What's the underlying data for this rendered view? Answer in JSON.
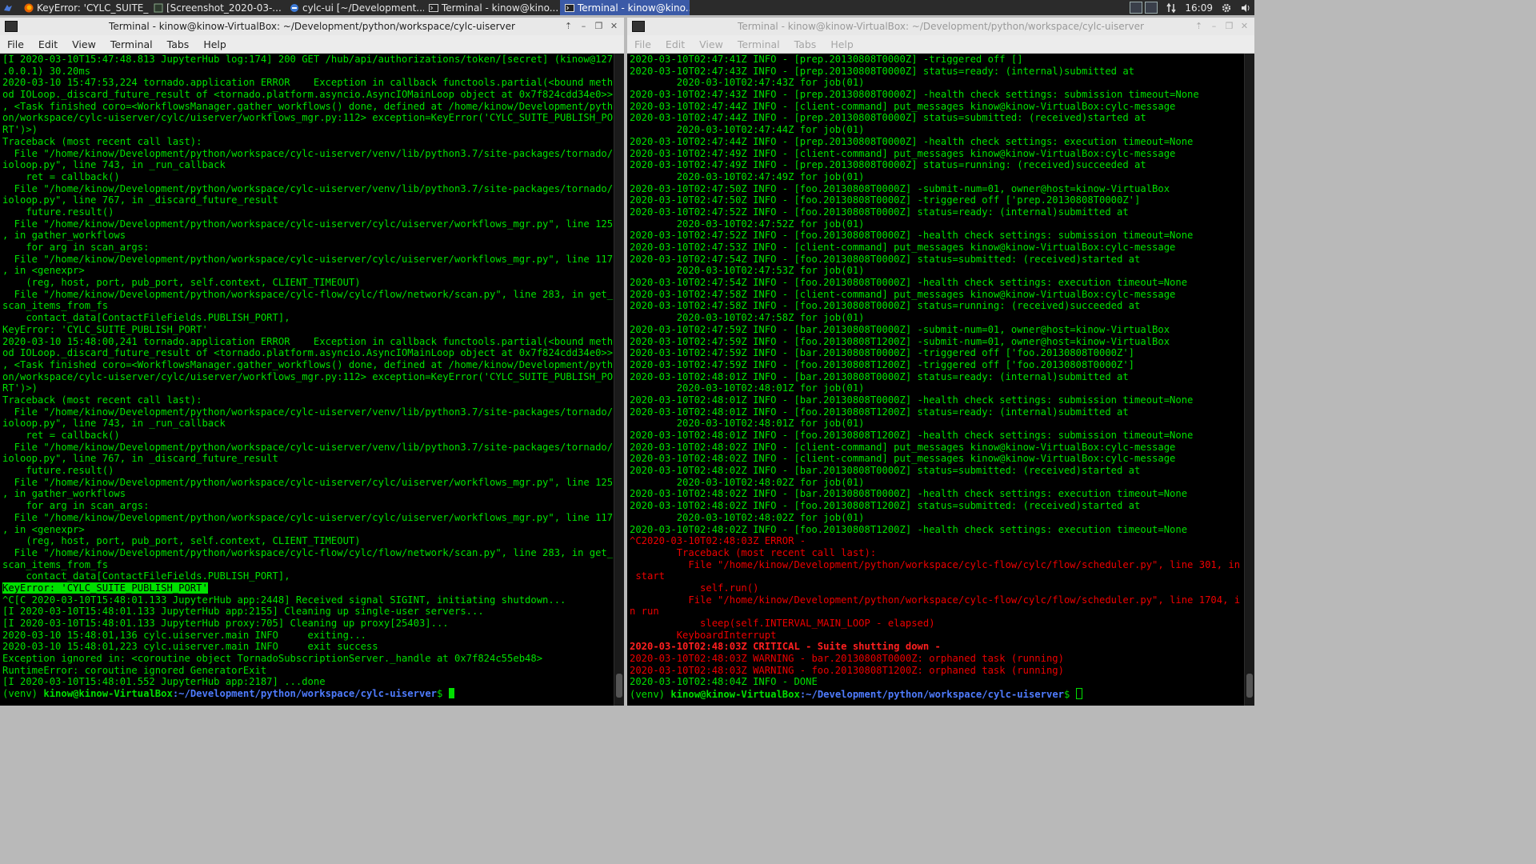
{
  "taskbar": {
    "items": [
      {
        "label": "KeyError: 'CYLC_SUITE_...",
        "icon": "firefox-icon",
        "active": false
      },
      {
        "label": "[Screenshot_2020-03-...",
        "icon": "image-viewer-icon",
        "active": false
      },
      {
        "label": "cylc-ui [~/Development...",
        "icon": "ide-icon",
        "active": false
      },
      {
        "label": "Terminal - kinow@kino...",
        "icon": "terminal-icon",
        "active": false
      },
      {
        "label": "Terminal - kinow@kino...",
        "icon": "terminal-icon",
        "active": true
      }
    ],
    "clock": "16:09"
  },
  "left_window": {
    "title": "Terminal - kinow@kinow-VirtualBox: ~/Development/python/workspace/cylc-uiserver",
    "menu": [
      "File",
      "Edit",
      "View",
      "Terminal",
      "Tabs",
      "Help"
    ],
    "lines": [
      {
        "t": "[I 2020-03-10T15:47:48.813 JupyterHub log:174] 200 GET /hub/api/authorizations/token/[secret] (kinow@127",
        "c": "g"
      },
      {
        "t": ".0.0.1) 30.20ms",
        "c": "g"
      },
      {
        "t": "2020-03-10 15:47:53,224 tornado.application ERROR    Exception in callback functools.partial(<bound meth",
        "c": "g"
      },
      {
        "t": "od IOLoop._discard_future_result of <tornado.platform.asyncio.AsyncIOMainLoop object at 0x7f824cdd34e0>>",
        "c": "g"
      },
      {
        "t": ", <Task finished coro=<WorkflowsManager.gather_workflows() done, defined at /home/kinow/Development/pyth",
        "c": "g"
      },
      {
        "t": "on/workspace/cylc-uiserver/cylc/uiserver/workflows_mgr.py:112> exception=KeyError('CYLC_SUITE_PUBLISH_PO",
        "c": "g"
      },
      {
        "t": "RT')>)",
        "c": "g"
      },
      {
        "t": "Traceback (most recent call last):",
        "c": "g"
      },
      {
        "t": "  File \"/home/kinow/Development/python/workspace/cylc-uiserver/venv/lib/python3.7/site-packages/tornado/",
        "c": "g"
      },
      {
        "t": "ioloop.py\", line 743, in _run_callback",
        "c": "g"
      },
      {
        "t": "    ret = callback()",
        "c": "g"
      },
      {
        "t": "  File \"/home/kinow/Development/python/workspace/cylc-uiserver/venv/lib/python3.7/site-packages/tornado/",
        "c": "g"
      },
      {
        "t": "ioloop.py\", line 767, in _discard_future_result",
        "c": "g"
      },
      {
        "t": "    future.result()",
        "c": "g"
      },
      {
        "t": "  File \"/home/kinow/Development/python/workspace/cylc-uiserver/cylc/uiserver/workflows_mgr.py\", line 125",
        "c": "g"
      },
      {
        "t": ", in gather_workflows",
        "c": "g"
      },
      {
        "t": "    for arg in scan_args:",
        "c": "g"
      },
      {
        "t": "  File \"/home/kinow/Development/python/workspace/cylc-uiserver/cylc/uiserver/workflows_mgr.py\", line 117",
        "c": "g"
      },
      {
        "t": ", in <genexpr>",
        "c": "g"
      },
      {
        "t": "    (reg, host, port, pub_port, self.context, CLIENT_TIMEOUT)",
        "c": "g"
      },
      {
        "t": "  File \"/home/kinow/Development/python/workspace/cylc-flow/cylc/flow/network/scan.py\", line 283, in get_",
        "c": "g"
      },
      {
        "t": "scan_items_from_fs",
        "c": "g"
      },
      {
        "t": "    contact_data[ContactFileFields.PUBLISH_PORT],",
        "c": "g"
      },
      {
        "t": "KeyError: 'CYLC_SUITE_PUBLISH_PORT'",
        "c": "g"
      },
      {
        "t": "2020-03-10 15:48:00,241 tornado.application ERROR    Exception in callback functools.partial(<bound meth",
        "c": "g"
      },
      {
        "t": "od IOLoop._discard_future_result of <tornado.platform.asyncio.AsyncIOMainLoop object at 0x7f824cdd34e0>>",
        "c": "g"
      },
      {
        "t": ", <Task finished coro=<WorkflowsManager.gather_workflows() done, defined at /home/kinow/Development/pyth",
        "c": "g"
      },
      {
        "t": "on/workspace/cylc-uiserver/cylc/uiserver/workflows_mgr.py:112> exception=KeyError('CYLC_SUITE_PUBLISH_PO",
        "c": "g"
      },
      {
        "t": "RT')>)",
        "c": "g"
      },
      {
        "t": "Traceback (most recent call last):",
        "c": "g"
      },
      {
        "t": "  File \"/home/kinow/Development/python/workspace/cylc-uiserver/venv/lib/python3.7/site-packages/tornado/",
        "c": "g"
      },
      {
        "t": "ioloop.py\", line 743, in _run_callback",
        "c": "g"
      },
      {
        "t": "    ret = callback()",
        "c": "g"
      },
      {
        "t": "  File \"/home/kinow/Development/python/workspace/cylc-uiserver/venv/lib/python3.7/site-packages/tornado/",
        "c": "g"
      },
      {
        "t": "ioloop.py\", line 767, in _discard_future_result",
        "c": "g"
      },
      {
        "t": "    future.result()",
        "c": "g"
      },
      {
        "t": "  File \"/home/kinow/Development/python/workspace/cylc-uiserver/cylc/uiserver/workflows_mgr.py\", line 125",
        "c": "g"
      },
      {
        "t": ", in gather_workflows",
        "c": "g"
      },
      {
        "t": "    for arg in scan_args:",
        "c": "g"
      },
      {
        "t": "  File \"/home/kinow/Development/python/workspace/cylc-uiserver/cylc/uiserver/workflows_mgr.py\", line 117",
        "c": "g"
      },
      {
        "t": ", in <genexpr>",
        "c": "g"
      },
      {
        "t": "    (reg, host, port, pub_port, self.context, CLIENT_TIMEOUT)",
        "c": "g"
      },
      {
        "t": "  File \"/home/kinow/Development/python/workspace/cylc-flow/cylc/flow/network/scan.py\", line 283, in get_",
        "c": "g"
      },
      {
        "t": "scan_items_from_fs",
        "c": "g"
      },
      {
        "t": "    contact_data[ContactFileFields.PUBLISH_PORT],",
        "c": "g"
      },
      {
        "t": "KeyError: 'CYLC_SUITE_PUBLISH_PORT'",
        "c": "hl"
      },
      {
        "t": "^C[C 2020-03-10T15:48:01.133 JupyterHub app:2448] Received signal SIGINT, initiating shutdown...",
        "c": "g"
      },
      {
        "t": "[I 2020-03-10T15:48:01.133 JupyterHub app:2155] Cleaning up single-user servers...",
        "c": "g"
      },
      {
        "t": "[I 2020-03-10T15:48:01.133 JupyterHub proxy:705] Cleaning up proxy[25403]...",
        "c": "g"
      },
      {
        "t": "2020-03-10 15:48:01,136 cylc.uiserver.main INFO     exiting...",
        "c": "g"
      },
      {
        "t": "2020-03-10 15:48:01,223 cylc.uiserver.main INFO     exit success",
        "c": "g"
      },
      {
        "t": "Exception ignored in: <coroutine object TornadoSubscriptionServer._handle at 0x7f824c55eb48>",
        "c": "g"
      },
      {
        "t": "RuntimeError: coroutine ignored GeneratorExit",
        "c": "g"
      },
      {
        "t": "[I 2020-03-10T15:48:01.552 JupyterHub app:2187] ...done",
        "c": "g"
      }
    ],
    "prompt": {
      "venv": "(venv) ",
      "user": "kinow@kinow-VirtualBox",
      "path": ":~/Development/python/workspace/cylc-uiserver",
      "symbol": "$ "
    }
  },
  "right_window": {
    "title": "Terminal - kinow@kinow-VirtualBox: ~/Development/python/workspace/cylc-uiserver",
    "menu": [
      "File",
      "Edit",
      "View",
      "Terminal",
      "Tabs",
      "Help"
    ],
    "lines": [
      {
        "t": "2020-03-10T02:47:41Z INFO - [prep.20130808T0000Z] -triggered off []",
        "c": "g"
      },
      {
        "t": "2020-03-10T02:47:43Z INFO - [prep.20130808T0000Z] status=ready: (internal)submitted at",
        "c": "g"
      },
      {
        "t": "        2020-03-10T02:47:43Z for job(01)",
        "c": "g"
      },
      {
        "t": "2020-03-10T02:47:43Z INFO - [prep.20130808T0000Z] -health check settings: submission timeout=None",
        "c": "g"
      },
      {
        "t": "2020-03-10T02:47:44Z INFO - [client-command] put_messages kinow@kinow-VirtualBox:cylc-message",
        "c": "g"
      },
      {
        "t": "2020-03-10T02:47:44Z INFO - [prep.20130808T0000Z] status=submitted: (received)started at",
        "c": "g"
      },
      {
        "t": "        2020-03-10T02:47:44Z for job(01)",
        "c": "g"
      },
      {
        "t": "2020-03-10T02:47:44Z INFO - [prep.20130808T0000Z] -health check settings: execution timeout=None",
        "c": "g"
      },
      {
        "t": "2020-03-10T02:47:49Z INFO - [client-command] put_messages kinow@kinow-VirtualBox:cylc-message",
        "c": "g"
      },
      {
        "t": "2020-03-10T02:47:49Z INFO - [prep.20130808T0000Z] status=running: (received)succeeded at",
        "c": "g"
      },
      {
        "t": "        2020-03-10T02:47:49Z for job(01)",
        "c": "g"
      },
      {
        "t": "2020-03-10T02:47:50Z INFO - [foo.20130808T0000Z] -submit-num=01, owner@host=kinow-VirtualBox",
        "c": "g"
      },
      {
        "t": "2020-03-10T02:47:50Z INFO - [foo.20130808T0000Z] -triggered off ['prep.20130808T0000Z']",
        "c": "g"
      },
      {
        "t": "2020-03-10T02:47:52Z INFO - [foo.20130808T0000Z] status=ready: (internal)submitted at",
        "c": "g"
      },
      {
        "t": "        2020-03-10T02:47:52Z for job(01)",
        "c": "g"
      },
      {
        "t": "2020-03-10T02:47:52Z INFO - [foo.20130808T0000Z] -health check settings: submission timeout=None",
        "c": "g"
      },
      {
        "t": "2020-03-10T02:47:53Z INFO - [client-command] put_messages kinow@kinow-VirtualBox:cylc-message",
        "c": "g"
      },
      {
        "t": "2020-03-10T02:47:54Z INFO - [foo.20130808T0000Z] status=submitted: (received)started at",
        "c": "g"
      },
      {
        "t": "        2020-03-10T02:47:53Z for job(01)",
        "c": "g"
      },
      {
        "t": "2020-03-10T02:47:54Z INFO - [foo.20130808T0000Z] -health check settings: execution timeout=None",
        "c": "g"
      },
      {
        "t": "2020-03-10T02:47:58Z INFO - [client-command] put_messages kinow@kinow-VirtualBox:cylc-message",
        "c": "g"
      },
      {
        "t": "2020-03-10T02:47:58Z INFO - [foo.20130808T0000Z] status=running: (received)succeeded at",
        "c": "g"
      },
      {
        "t": "        2020-03-10T02:47:58Z for job(01)",
        "c": "g"
      },
      {
        "t": "2020-03-10T02:47:59Z INFO - [bar.20130808T0000Z] -submit-num=01, owner@host=kinow-VirtualBox",
        "c": "g"
      },
      {
        "t": "2020-03-10T02:47:59Z INFO - [foo.20130808T1200Z] -submit-num=01, owner@host=kinow-VirtualBox",
        "c": "g"
      },
      {
        "t": "2020-03-10T02:47:59Z INFO - [bar.20130808T0000Z] -triggered off ['foo.20130808T0000Z']",
        "c": "g"
      },
      {
        "t": "2020-03-10T02:47:59Z INFO - [foo.20130808T1200Z] -triggered off ['foo.20130808T0000Z']",
        "c": "g"
      },
      {
        "t": "2020-03-10T02:48:01Z INFO - [bar.20130808T0000Z] status=ready: (internal)submitted at",
        "c": "g"
      },
      {
        "t": "        2020-03-10T02:48:01Z for job(01)",
        "c": "g"
      },
      {
        "t": "2020-03-10T02:48:01Z INFO - [bar.20130808T0000Z] -health check settings: submission timeout=None",
        "c": "g"
      },
      {
        "t": "2020-03-10T02:48:01Z INFO - [foo.20130808T1200Z] status=ready: (internal)submitted at",
        "c": "g"
      },
      {
        "t": "        2020-03-10T02:48:01Z for job(01)",
        "c": "g"
      },
      {
        "t": "2020-03-10T02:48:01Z INFO - [foo.20130808T1200Z] -health check settings: submission timeout=None",
        "c": "g"
      },
      {
        "t": "2020-03-10T02:48:02Z INFO - [client-command] put_messages kinow@kinow-VirtualBox:cylc-message",
        "c": "g"
      },
      {
        "t": "2020-03-10T02:48:02Z INFO - [client-command] put_messages kinow@kinow-VirtualBox:cylc-message",
        "c": "g"
      },
      {
        "t": "2020-03-10T02:48:02Z INFO - [bar.20130808T0000Z] status=submitted: (received)started at",
        "c": "g"
      },
      {
        "t": "        2020-03-10T02:48:02Z for job(01)",
        "c": "g"
      },
      {
        "t": "2020-03-10T02:48:02Z INFO - [bar.20130808T0000Z] -health check settings: execution timeout=None",
        "c": "g"
      },
      {
        "t": "2020-03-10T02:48:02Z INFO - [foo.20130808T1200Z] status=submitted: (received)started at",
        "c": "g"
      },
      {
        "t": "        2020-03-10T02:48:02Z for job(01)",
        "c": "g"
      },
      {
        "t": "2020-03-10T02:48:02Z INFO - [foo.20130808T1200Z] -health check settings: execution timeout=None",
        "c": "g"
      },
      {
        "t": "^C2020-03-10T02:48:03Z ERROR -",
        "c": "r"
      },
      {
        "t": "        Traceback (most recent call last):",
        "c": "r"
      },
      {
        "t": "          File \"/home/kinow/Development/python/workspace/cylc-flow/cylc/flow/scheduler.py\", line 301, in",
        "c": "r"
      },
      {
        "t": " start",
        "c": "r"
      },
      {
        "t": "            self.run()",
        "c": "r"
      },
      {
        "t": "          File \"/home/kinow/Development/python/workspace/cylc-flow/cylc/flow/scheduler.py\", line 1704, i",
        "c": "r"
      },
      {
        "t": "n run",
        "c": "r"
      },
      {
        "t": "            sleep(self.INTERVAL_MAIN_LOOP - elapsed)",
        "c": "r"
      },
      {
        "t": "        KeyboardInterrupt",
        "c": "r"
      },
      {
        "t": "2020-03-10T02:48:03Z CRITICAL - Suite shutting down -",
        "c": "rb"
      },
      {
        "t": "2020-03-10T02:48:03Z WARNING - bar.20130808T0000Z: orphaned task (running)",
        "c": "r"
      },
      {
        "t": "2020-03-10T02:48:03Z WARNING - foo.20130808T1200Z: orphaned task (running)",
        "c": "r"
      },
      {
        "t": "2020-03-10T02:48:04Z INFO - DONE",
        "c": "g"
      }
    ],
    "prompt": {
      "venv": "(venv) ",
      "user": "kinow@kinow-VirtualBox",
      "path": ":~/Development/python/workspace/cylc-uiserver",
      "symbol": "$ "
    }
  }
}
